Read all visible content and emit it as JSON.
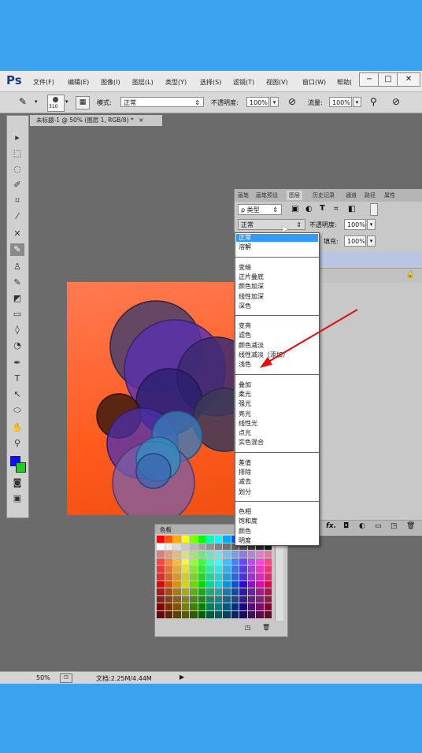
{
  "app": {
    "logo": "Ps"
  },
  "menu": [
    "文件(F)",
    "编辑(E)",
    "图像(I)",
    "图层(L)",
    "类型(Y)",
    "选择(S)",
    "滤镜(T)",
    "视图(V)",
    "窗口(W)",
    "帮助("
  ],
  "window_buttons": {
    "minimize": "−",
    "maximize": "□",
    "close": "✕"
  },
  "options": {
    "brush_size": "310",
    "mode_label": "模式:",
    "mode_value": "正常",
    "opacity_label": "不透明度:",
    "opacity_value": "100%",
    "flow_label": "流量:",
    "flow_value": "100%"
  },
  "document": {
    "tab_title": "未标题-1 @ 50% (图层 1, RGB/8) *",
    "tab_close": "×"
  },
  "panel": {
    "tabs": [
      "画笔",
      "画笔预设",
      "图层",
      "历史记录",
      "通道",
      "路径",
      "属性"
    ],
    "filter_label": "ρ 类型",
    "blend_value": "正常",
    "opacity_label": "不透明度:",
    "opacity_value": "100%",
    "fill_label": "填充:",
    "fill_value": "100%"
  },
  "blend_modes": [
    [
      "正常",
      "溶解"
    ],
    [
      "变暗",
      "正片叠底",
      "颜色加深",
      "线性加深",
      "深色"
    ],
    [
      "变亮",
      "滤色",
      "颜色减淡",
      "线性减淡（添加）",
      "浅色"
    ],
    [
      "叠加",
      "柔光",
      "强光",
      "亮光",
      "线性光",
      "点光",
      "实色混合"
    ],
    [
      "差值",
      "排除",
      "减去",
      "划分"
    ],
    [
      "色相",
      "饱和度",
      "颜色",
      "明度"
    ]
  ],
  "swatches": {
    "title": "色板"
  },
  "status": {
    "zoom": "50%",
    "doc_info": "文档:2.25M/4.44M"
  },
  "colors": {
    "accent_selection": "#3399ff",
    "arrow": "#e01010",
    "foreground": "#1010ff",
    "background": "#22cc22"
  }
}
